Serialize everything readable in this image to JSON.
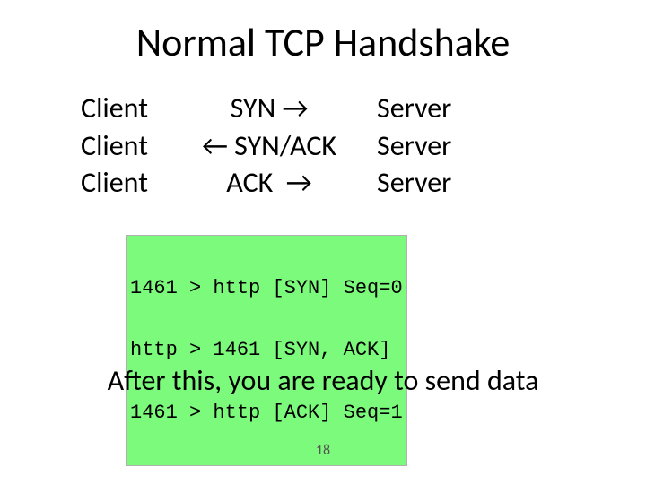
{
  "title": "Normal TCP Handshake",
  "handshake": [
    {
      "client": "Client",
      "mid": "SYN →",
      "server": "Server"
    },
    {
      "client": "Client",
      "mid": "← SYN/ACK",
      "server": "Server"
    },
    {
      "client": "Client",
      "mid": "ACK  →",
      "server": "Server"
    }
  ],
  "capture": [
    "1461 > http [SYN] Seq=0",
    "http > 1461 [SYN, ACK]",
    "1461 > http [ACK] Seq=1"
  ],
  "footer": "After this, you are ready to send data",
  "page_number": "18"
}
